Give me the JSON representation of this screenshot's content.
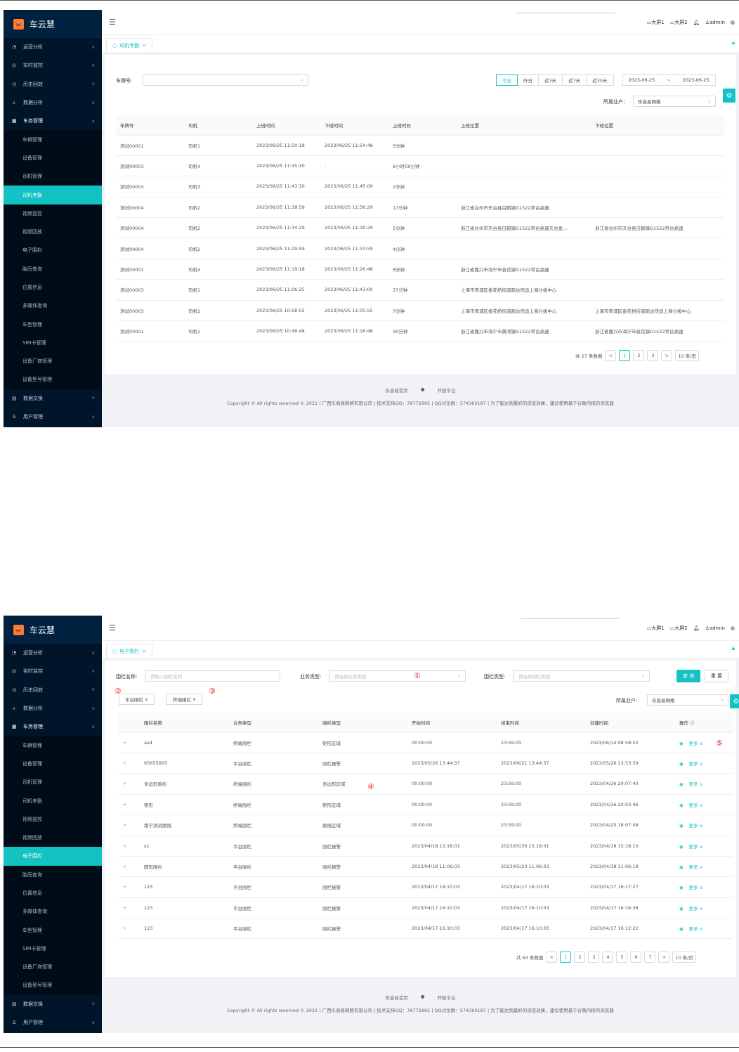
{
  "common": {
    "app_name": "车云慧",
    "logo_text": "车云慧",
    "fold_icon": "menu-fold-icon",
    "top_right": {
      "screen1": "大屏1",
      "screen2": "大屏2",
      "user": "admin"
    },
    "footer": {
      "link1": "乐高易首页",
      "link2": "开放平台",
      "copyright": "Copyright © All rights reserved © 2021 | 广西乐高易网络有限公司 | 技术支持QQ：78772895 | QQ讨论群：574360187 | 为了能达到最好的浏览效果，建议使用基于谷歌内核的浏览器"
    },
    "menu_top": [
      "运营分析",
      "实时监控",
      "历史回放",
      "数据分析",
      "车务管理"
    ],
    "menu_bottom": [
      "数据交换",
      "用户管理"
    ]
  },
  "s1": {
    "submenu": [
      "车辆管理",
      "设备管理",
      "司机管理",
      "司机考勤",
      "视频监控",
      "视频回放",
      "电子围栏",
      "胎压查询",
      "位置信息",
      "多媒体查询",
      "车型管理",
      "SIM卡管理",
      "设备厂商管理",
      "设备型号管理"
    ],
    "tab_label": "司机考勤",
    "plate_label": "车牌号:",
    "date_buttons": [
      "今日",
      "昨日",
      "近3天",
      "近7天",
      "近30天"
    ],
    "date_start": "2023-06-25",
    "date_sep": "~",
    "date_end": "2023-06-25",
    "tenant_label": "所属业户：",
    "tenant_value": "乐高易网络",
    "columns": [
      "车牌号",
      "司机",
      "上班时间",
      "下班时间",
      "上班时长",
      "上班位置",
      "下班位置"
    ],
    "rows": [
      [
        "测试00001",
        "司机1",
        "2023/06/25 11:50:18",
        "2023/06/25 11:54:48",
        "5分钟",
        "",
        ""
      ],
      [
        "测试00003",
        "司机4",
        "2023/06/25 11:45:30",
        "-",
        "6小时59分钟",
        "",
        ""
      ],
      [
        "测试00003",
        "司机3",
        "2023/06/25 11:43:30",
        "2023/06/25 11:45:00",
        "2分钟",
        "",
        ""
      ],
      [
        "测试00004",
        "司机2",
        "2023/06/25 11:39:59",
        "2023/06/25 11:56:29",
        "17分钟",
        "浙江省台州市天台县白鹤镇G1522常台高速",
        ""
      ],
      [
        "测试00004",
        "司机2",
        "2023/06/25 11:34:29",
        "2023/06/25 11:39:29",
        "5分钟",
        "浙江省台州市天台县白鹤镇G1522常台高速天台金...",
        "浙江省台州市天台县白鹤镇G1522常台高速"
      ],
      [
        "测试00004",
        "司机2",
        "2023/06/25 11:29:59",
        "2023/06/25 11:33:59",
        "4分钟",
        "",
        ""
      ],
      [
        "测试00001",
        "司机4",
        "2023/06/25 11:19:18",
        "2023/06/25 11:26:48",
        "8分钟",
        "浙江省嘉兴市海宁市袁花镇G1522常台高速",
        ""
      ],
      [
        "测试00003",
        "司机1",
        "2023/06/25 11:06:25",
        "2023/06/25 11:43:00",
        "37分钟",
        "上海市青浦区香花桥街道跑达快运上海分拨中心",
        ""
      ],
      [
        "测试00003",
        "司机2",
        "2023/06/25 10:58:55",
        "2023/06/25 11:05:55",
        "7分钟",
        "上海市青浦区香花桥街道跑达快运上海分拨中心",
        "上海市青浦区香花桥街道跑达快运上海分拨中心"
      ],
      [
        "测试00001",
        "司机1",
        "2023/06/25 10:48:48",
        "2023/06/25 11:18:48",
        "30分钟",
        "浙江省嘉兴市海宁市黄湾镇G1522常台高速",
        "浙江省嘉兴市海宁市袁花镇G1522常台高速"
      ]
    ],
    "total_text": "共 27 条数据",
    "pages": [
      "1",
      "2",
      "3"
    ],
    "page_size": "10 条/页",
    "prev": "<",
    "next": ">"
  },
  "s2": {
    "submenu": [
      "车辆管理",
      "设备管理",
      "司机管理",
      "司机考勤",
      "视频监控",
      "视频回放",
      "电子围栏",
      "胎压查询",
      "位置信息",
      "多媒体查询",
      "车型管理",
      "SIM卡管理",
      "设备厂商管理",
      "设备型号管理"
    ],
    "tab_label": "电子围栏",
    "name_label": "围栏名称:",
    "name_placeholder": "请输入围栏名称",
    "biz_label": "业务类型:",
    "biz_placeholder": "请选择业务类型",
    "fence_label": "围栏类型:",
    "fence_placeholder": "请选择围栏类型",
    "query_btn": "查 询",
    "reset_btn": "重 置",
    "platform_btn": "平台围栏",
    "terminal_btn": "终端围栏",
    "tenant_label": "所属业户:",
    "tenant_value": "乐高易网络",
    "markers": [
      "①",
      "②",
      "③",
      "④",
      "⑤"
    ],
    "columns": [
      "",
      "围栏名称",
      "业务类型",
      "围栏类型",
      "开始时间",
      "结束时间",
      "创建时间",
      "操作 ⓘ"
    ],
    "rows": [
      [
        "+",
        "asd",
        "终端围栏",
        "矩形区域",
        "00:00:00",
        "23:59:00",
        "2023/06/14 08:58:52"
      ],
      [
        "+",
        "65655665",
        "平台围栏",
        "围栏报警",
        "2023/05/26 13:44:37",
        "2023/06/21 13:44:37",
        "2023/05/26 13:53:59"
      ],
      [
        "+",
        "多边形围栏",
        "终端围栏",
        "多边形区域",
        "00:00:00",
        "23:59:00",
        "2023/04/26 20:07:40"
      ],
      [
        "+",
        "矩形",
        "终端围栏",
        "矩形区域",
        "00:00:00",
        "23:59:00",
        "2023/04/26 20:03:46"
      ],
      [
        "+",
        "南宁测试路线",
        "终端围栏",
        "路线区域",
        "00:00:00",
        "23:59:00",
        "2023/04/25 18:07:08"
      ],
      [
        "+",
        "sz",
        "平台围栏",
        "围栏报警",
        "2023/04/18 15:18:01",
        "2023/05/30 15:18:01",
        "2023/04/18 15:18:10"
      ],
      [
        "+",
        "圆形围栏",
        "平台围栏",
        "围栏报警",
        "2023/04/18 11:06:03",
        "2023/05/23 11:06:03",
        "2023/04/18 11:06:18"
      ],
      [
        "+",
        "123",
        "平台围栏",
        "围栏报警",
        "2023/04/17 16:10:03",
        "2023/04/17 16:10:03",
        "2023/04/17 16:17:27"
      ],
      [
        "+",
        "123",
        "平台围栏",
        "围栏报警",
        "2023/04/17 16:10:03",
        "2023/04/17 16:10:03",
        "2023/04/17 16:16:36"
      ],
      [
        "+",
        "123",
        "平台围栏",
        "围栏报警",
        "2023/04/17 16:10:03",
        "2023/04/17 16:10:03",
        "2023/04/17 16:12:22"
      ]
    ],
    "op_more": "更多 ∨",
    "total_text": "共 63 条数据",
    "pages": [
      "1",
      "2",
      "3",
      "4",
      "5",
      "6",
      "7"
    ],
    "page_size": "10 条/页",
    "prev": "<",
    "next": ">"
  }
}
